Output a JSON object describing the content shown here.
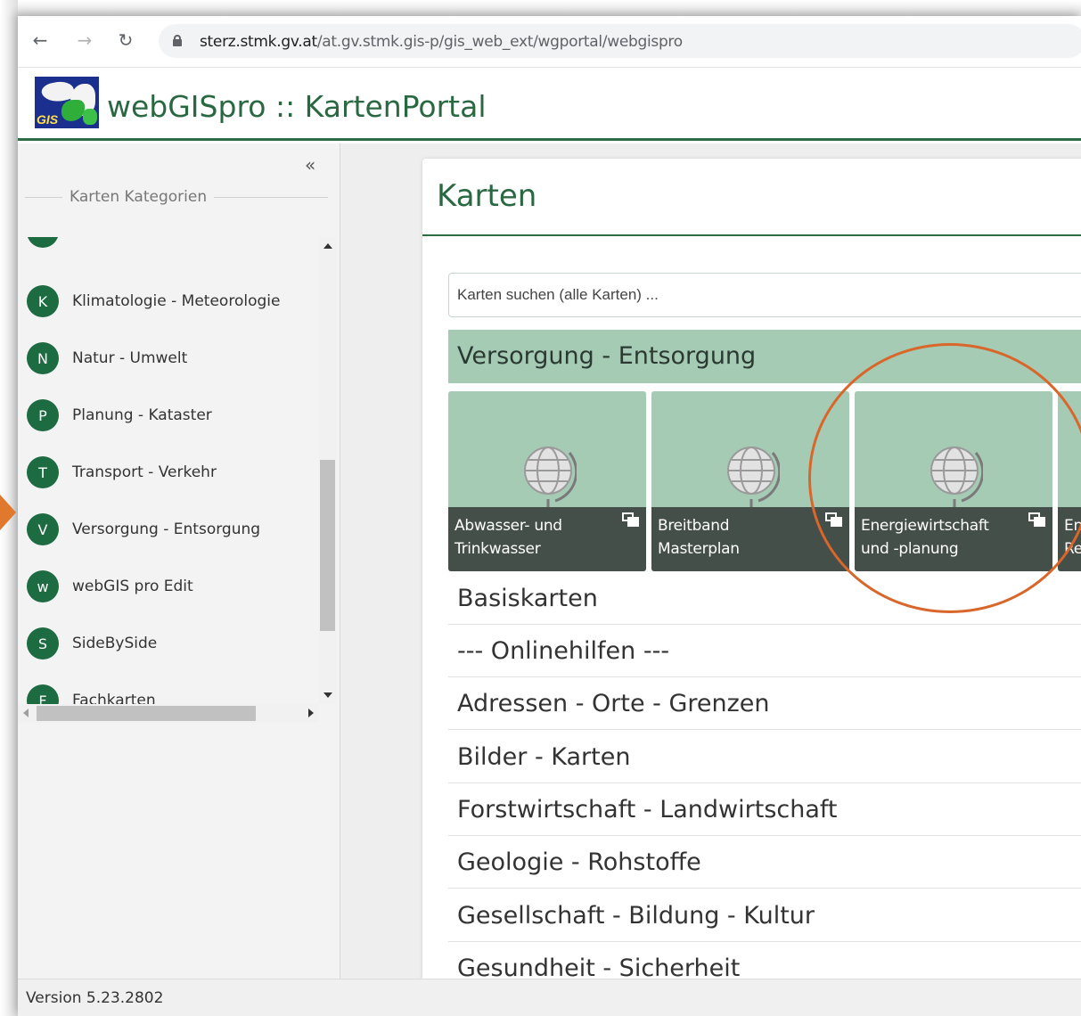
{
  "browser": {
    "url_host": "sterz.stmk.gv.at",
    "url_path": "/at.gv.stmk.gis-p/gis_web_ext/wgportal/webgispro"
  },
  "app": {
    "title": "webGISpro :: KartenPortal",
    "logo_text": "GIS"
  },
  "sidebar": {
    "collapse_label": "«",
    "section_label": "Karten Kategorien",
    "items": [
      {
        "letter": "",
        "label": ""
      },
      {
        "letter": "K",
        "label": "Klimatologie - Meteorologie"
      },
      {
        "letter": "N",
        "label": "Natur - Umwelt"
      },
      {
        "letter": "P",
        "label": "Planung - Kataster"
      },
      {
        "letter": "T",
        "label": "Transport - Verkehr"
      },
      {
        "letter": "V",
        "label": "Versorgung - Entsorgung"
      },
      {
        "letter": "w",
        "label": "webGIS pro Edit"
      },
      {
        "letter": "S",
        "label": "SideBySide"
      },
      {
        "letter": "F",
        "label": "Fachkarten"
      }
    ]
  },
  "main": {
    "title": "Karten",
    "search_placeholder": "Karten suchen (alle Karten) ...",
    "active_group": "Versorgung - Entsorgung",
    "tiles": [
      {
        "line1": "Abwasser- und",
        "line2": "Trinkwasser",
        "icon": "globe-icon"
      },
      {
        "line1": "Breitband",
        "line2": "Masterplan",
        "icon": "globe-icon"
      },
      {
        "line1": "Energiewirtschaft",
        "line2": "und -planung",
        "icon": "globe-icon"
      },
      {
        "line1": "En",
        "line2": "Re",
        "icon": "globe-icon"
      }
    ],
    "categories": [
      "Basiskarten",
      "--- Onlinehilfen ---",
      "Adressen - Orte - Grenzen",
      "Bilder - Karten",
      "Forstwirtschaft - Landwirtschaft",
      "Geologie - Rohstoffe",
      "Gesellschaft - Bildung - Kultur",
      "Gesundheit - Sicherheit"
    ]
  },
  "footer": {
    "version": "Version 5.23.2802"
  },
  "colors": {
    "brand_green": "#2e6b47",
    "tile_green": "#a5cbb4",
    "annotation_orange": "#d9662a"
  }
}
